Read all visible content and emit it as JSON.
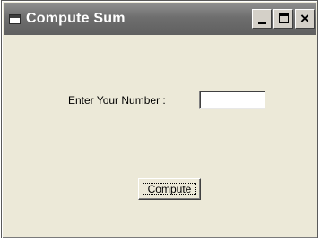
{
  "window": {
    "title": "Compute Sum",
    "icon": "app-window-icon",
    "controls": {
      "minimize_icon": "minimize-icon",
      "maximize_icon": "maximize-icon",
      "close_icon": "close-icon",
      "close_glyph": "×"
    }
  },
  "form": {
    "number_label": "Enter Your Number :",
    "number_value": "",
    "compute_label": "Compute"
  }
}
